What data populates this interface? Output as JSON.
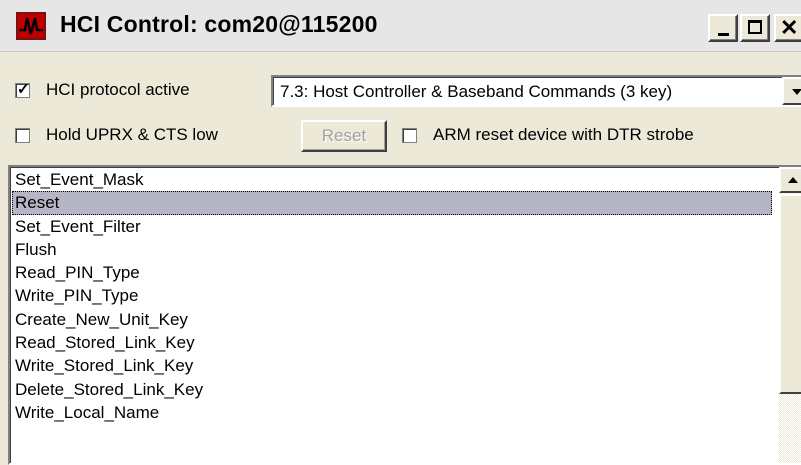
{
  "window": {
    "title": "HCI Control: com20@115200",
    "controls": {
      "minimize": "minimize",
      "maximize": "maximize",
      "close": "close"
    }
  },
  "options": {
    "hci_protocol_active": {
      "label": "HCI protocol active",
      "checked": true
    },
    "hold_uprx_cts": {
      "label": "Hold UPRX & CTS low",
      "checked": false
    },
    "arm_reset": {
      "label": "ARM reset device with DTR strobe",
      "checked": false
    },
    "reset_button": {
      "label": "Reset",
      "enabled": false
    }
  },
  "command_group": {
    "selected": "7.3: Host Controller & Baseband Commands (3 key)"
  },
  "commands": {
    "selected": "Reset",
    "items": [
      "Set_Event_Mask",
      "Reset",
      "Set_Event_Filter",
      "Flush",
      "Read_PIN_Type",
      "Write_PIN_Type",
      "Create_New_Unit_Key",
      "Read_Stored_Link_Key",
      "Write_Stored_Link_Key",
      "Delete_Stored_Link_Key",
      "Write_Local_Name"
    ]
  },
  "colors": {
    "selection": "#b5b5c6",
    "dialog_face": "#ece9d8",
    "icon_red": "#c00000"
  }
}
